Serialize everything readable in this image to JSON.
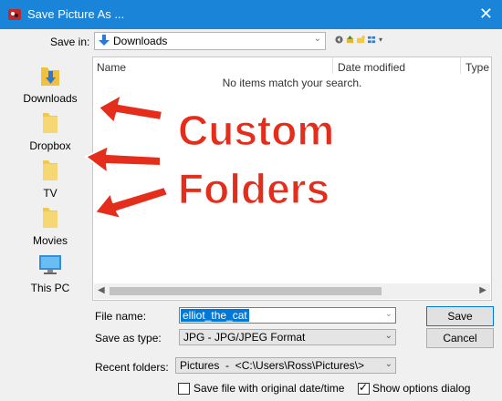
{
  "window": {
    "title": "Save Picture As ..."
  },
  "header": {
    "save_in_label": "Save in:",
    "save_in_value": "Downloads"
  },
  "places": [
    {
      "label": "Downloads",
      "icon": "downloads-folder-icon"
    },
    {
      "label": "Dropbox",
      "icon": "folder-icon"
    },
    {
      "label": "TV",
      "icon": "folder-icon"
    },
    {
      "label": "Movies",
      "icon": "folder-icon"
    },
    {
      "label": "This PC",
      "icon": "computer-icon"
    }
  ],
  "file_list": {
    "columns": [
      "Name",
      "Date modified",
      "Type"
    ],
    "empty_message": "No items match your search."
  },
  "form": {
    "file_name_label": "File name:",
    "file_name_value": "elliot_the_cat",
    "save_as_type_label": "Save as type:",
    "save_as_type_value": "JPG - JPG/JPEG Format",
    "recent_folders_label": "Recent folders:",
    "recent_folders_value": "Pictures  -  <C:\\Users\\Ross\\Pictures\\>"
  },
  "buttons": {
    "save": "Save",
    "cancel": "Cancel"
  },
  "options": {
    "save_original_date_label": "Save file with original date/time",
    "save_original_date_checked": false,
    "show_options_label": "Show options dialog",
    "show_options_checked": true
  },
  "annotation": {
    "line1": "Custom",
    "line2": "Folders",
    "color": "#e52d1b"
  },
  "colors": {
    "titlebar": "#1a84d8",
    "selection": "#0078d7"
  }
}
